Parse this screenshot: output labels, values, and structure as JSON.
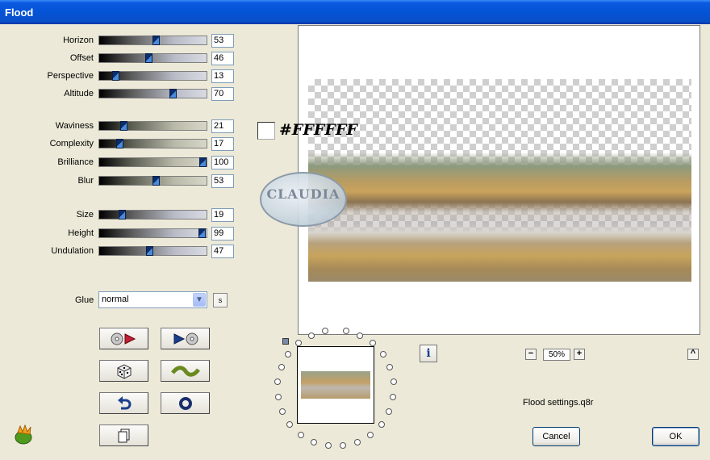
{
  "window": {
    "title": "Flood"
  },
  "sliders": [
    {
      "label": "Horizon",
      "value": "53",
      "fraction": 0.53,
      "style": "blue"
    },
    {
      "label": "Offset",
      "value": "46",
      "fraction": 0.46,
      "style": "blue"
    },
    {
      "label": "Perspective",
      "value": "13",
      "fraction": 0.13,
      "style": "blue"
    },
    {
      "label": "Altitude",
      "value": "70",
      "fraction": 0.7,
      "style": "blue"
    },
    {
      "label": "Waviness",
      "value": "21",
      "fraction": 0.21,
      "style": "olive"
    },
    {
      "label": "Complexity",
      "value": "17",
      "fraction": 0.17,
      "style": "olive"
    },
    {
      "label": "Brilliance",
      "value": "100",
      "fraction": 1.0,
      "style": "olive"
    },
    {
      "label": "Blur",
      "value": "53",
      "fraction": 0.53,
      "style": "olive"
    },
    {
      "label": "Size",
      "value": "19",
      "fraction": 0.19,
      "style": "blue"
    },
    {
      "label": "Height",
      "value": "99",
      "fraction": 0.99,
      "style": "blue"
    },
    {
      "label": "Undulation",
      "value": "47",
      "fraction": 0.47,
      "style": "blue"
    }
  ],
  "glue": {
    "label": "Glue",
    "value": "normal",
    "s_label": "s"
  },
  "tool_buttons": [
    {
      "name": "load-preset-button",
      "icon": "disc-play-icon"
    },
    {
      "name": "save-preset-button",
      "icon": "play-disc-icon"
    },
    {
      "name": "random-button",
      "icon": "dice-icon"
    },
    {
      "name": "wave-button",
      "icon": "wave-icon"
    },
    {
      "name": "undo-button",
      "icon": "undo-arrow-icon"
    },
    {
      "name": "reset-button",
      "icon": "ring-icon"
    },
    {
      "name": "copy-button",
      "icon": "pages-icon"
    }
  ],
  "preview": {
    "color_hex": "#FFFFFF",
    "watermark_text": "CLAUDIA"
  },
  "zoom": {
    "value": "50%",
    "minus": "−",
    "plus": "+"
  },
  "info_label": "i",
  "collapse_label": "^",
  "settings_file": "Flood settings.q8r",
  "buttons": {
    "cancel": "Cancel",
    "ok": "OK"
  },
  "colors": {
    "title_bar": "#0553d6",
    "thumb": "#0b2d6b",
    "background": "#ece9d8"
  }
}
